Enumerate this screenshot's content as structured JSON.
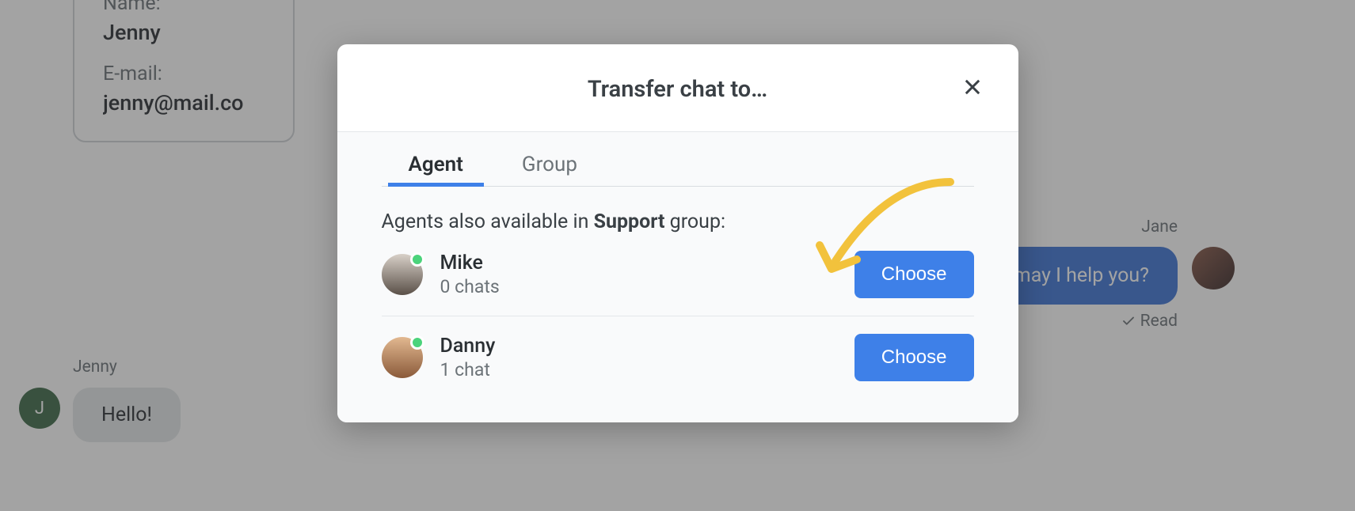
{
  "contact": {
    "name_label": "Name:",
    "name_value": "Jenny",
    "email_label": "E-mail:",
    "email_value": "jenny@mail.co"
  },
  "chat": {
    "left_sender": "Jenny",
    "left_avatar_initial": "J",
    "left_message": "Hello!",
    "right_sender": "Jane",
    "right_message": "ello, how may I help you?",
    "read_label": "Read"
  },
  "modal": {
    "title": "Transfer chat to…",
    "tabs": {
      "agent": "Agent",
      "group": "Group"
    },
    "helper_prefix": "Agents also available in ",
    "helper_group": "Support",
    "helper_suffix": " group:",
    "agents": [
      {
        "name": "Mike",
        "meta": "0 chats",
        "button": "Choose"
      },
      {
        "name": "Danny",
        "meta": "1 chat",
        "button": "Choose"
      }
    ]
  }
}
